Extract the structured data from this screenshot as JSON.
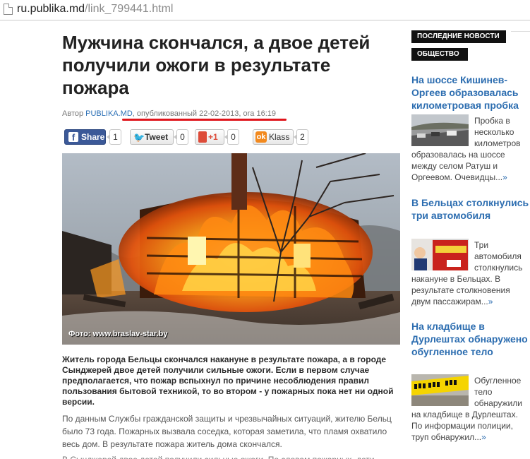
{
  "browser": {
    "url_domain": "ru.publika.md",
    "url_path": "/link_799441.html"
  },
  "article": {
    "title": "Мужчина скончался, а двое детей получили ожоги в результате пожара",
    "byline_prefix": "Автор ",
    "author": "PUBLIKA.MD",
    "published": ", опубликованный 22-02-2013, ora 16:19",
    "photo_credit": "Фото: www.braslav-star.by",
    "lead": "Житель города Бельцы скончался накануне в результате пожара, а в городе Сынджерей двое детей получили сильные ожоги. Если в первом случае предполагается, что пожар вспыхнул по причине несоблюдения правил пользования  бытовой техникой, то во втором - у пожарных пока нет ни одной версии.",
    "paragraph1": "По данным Службы гражданской защиты и чрезвычайных ситуаций, жителю Бельц было 73 года. Пожарных вызвала соседка, которая заметила, что пламя охватило весь дом. В результате пожара житель дома скончался.",
    "paragraph2_partial": "В Сынджерей двое детей получили сильные ожоги. По словам пожарных, дети"
  },
  "share": {
    "facebook_label": "Share",
    "facebook_count": "1",
    "twitter_label": "Tweet",
    "twitter_count": "0",
    "gplus_label": "+1",
    "gplus_count": "0",
    "ok_label": "Klass",
    "ok_count": "2",
    "facebook_icon": "f",
    "twitter_icon": "🐦",
    "ok_icon": "ok"
  },
  "sidebar": {
    "header_latest": "ПОСЛЕДНИЕ НОВОСТИ",
    "header_section": "ОБЩЕСТВО",
    "items": [
      {
        "title": "На шоссе Кишинев-Оргеев образовалась километровая пробка",
        "text": "Пробка в несколько километров образовалась на шоссе между селом Ратуш и Оргеевом. Очевидцы...",
        "more": "»"
      },
      {
        "title": "В Бельцах столкнулись три автомобиля",
        "text": "Три автомобиля столкнулись накануне в Бельцах. В результате столкновения двум пассажирам...",
        "more": "»"
      },
      {
        "title": "На кладбище в Дурлештах обнаружено обугленное тело",
        "text": "Обугленное тело обнаружили на кладбище в Дурлештах. По информации полиции, труп обнаружил...",
        "more": "»"
      }
    ]
  },
  "colors": {
    "link": "#2c6db0",
    "sidebar_header_bg": "#111111",
    "byline_underline": "#e0141b",
    "facebook": "#3b5998"
  }
}
